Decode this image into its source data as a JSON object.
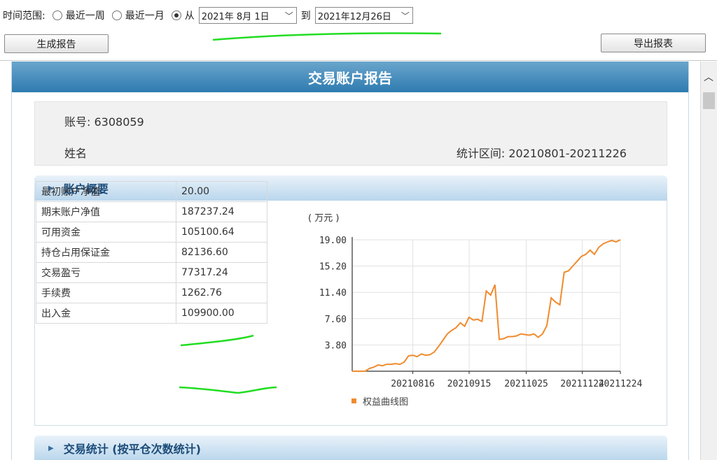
{
  "toolbar": {
    "time_range_label": "时间范围:",
    "opt_week": "最近一周",
    "opt_month": "最近一月",
    "opt_from": "从",
    "from_date": "2021年 8月 1日",
    "to_label": "到",
    "to_date": "2021年12月26日",
    "generate_button": "生成报告",
    "export_button": "导出报表",
    "selected_option": "从"
  },
  "report": {
    "title": "交易账户报告",
    "account_label": "账号: 6308059",
    "name_label": "姓名",
    "period_label": "统计区间: 20210801-20211226"
  },
  "sections": {
    "overview": "账户概要",
    "trade_stats": "交易统计 (按平仓次数统计)"
  },
  "summary": {
    "rows": [
      {
        "key": "最初账户净值",
        "value": "20.00"
      },
      {
        "key": "期末账户净值",
        "value": "187237.24"
      },
      {
        "key": "可用资金",
        "value": "105100.64"
      },
      {
        "key": "持仓占用保证金",
        "value": "82136.60"
      },
      {
        "key": "交易盈亏",
        "value": "77317.24"
      },
      {
        "key": "手续费",
        "value": "1262.76"
      },
      {
        "key": "出入金",
        "value": "109900.00"
      }
    ]
  },
  "colors": {
    "line": "#f08b2e",
    "header": "#2e7bb0",
    "annotation": "#22dd22"
  },
  "chart_data": {
    "type": "line",
    "unit_label": "( 万元 )",
    "y_ticks": [
      "19.00",
      "15.20",
      "11.40",
      "7.60",
      "3.80"
    ],
    "ylim": [
      0,
      19.0
    ],
    "x_ticks": [
      "20210816",
      "20210915",
      "20211025",
      "20211124",
      "20211224"
    ],
    "grid": true,
    "legend": "权益曲线图",
    "legend_position": "bottom-left",
    "series": [
      {
        "name": "权益曲线图",
        "values": [
          0.0,
          0.0,
          0.0,
          0.0,
          0.4,
          0.6,
          0.9,
          0.8,
          1.0,
          1.0,
          1.1,
          1.0,
          1.3,
          2.2,
          2.3,
          2.1,
          2.5,
          2.3,
          2.4,
          2.8,
          3.6,
          4.5,
          5.4,
          5.9,
          6.3,
          7.0,
          6.5,
          7.8,
          7.4,
          7.5,
          7.2,
          11.6,
          11.0,
          12.5,
          4.6,
          4.7,
          5.0,
          5.0,
          5.1,
          5.4,
          5.3,
          5.2,
          5.4,
          4.9,
          5.4,
          6.6,
          10.6,
          10.0,
          9.6,
          14.3,
          14.5,
          15.2,
          15.9,
          16.6,
          16.9,
          17.5,
          16.9,
          17.9,
          18.4,
          18.7,
          18.9,
          18.7,
          19.0
        ]
      }
    ]
  }
}
